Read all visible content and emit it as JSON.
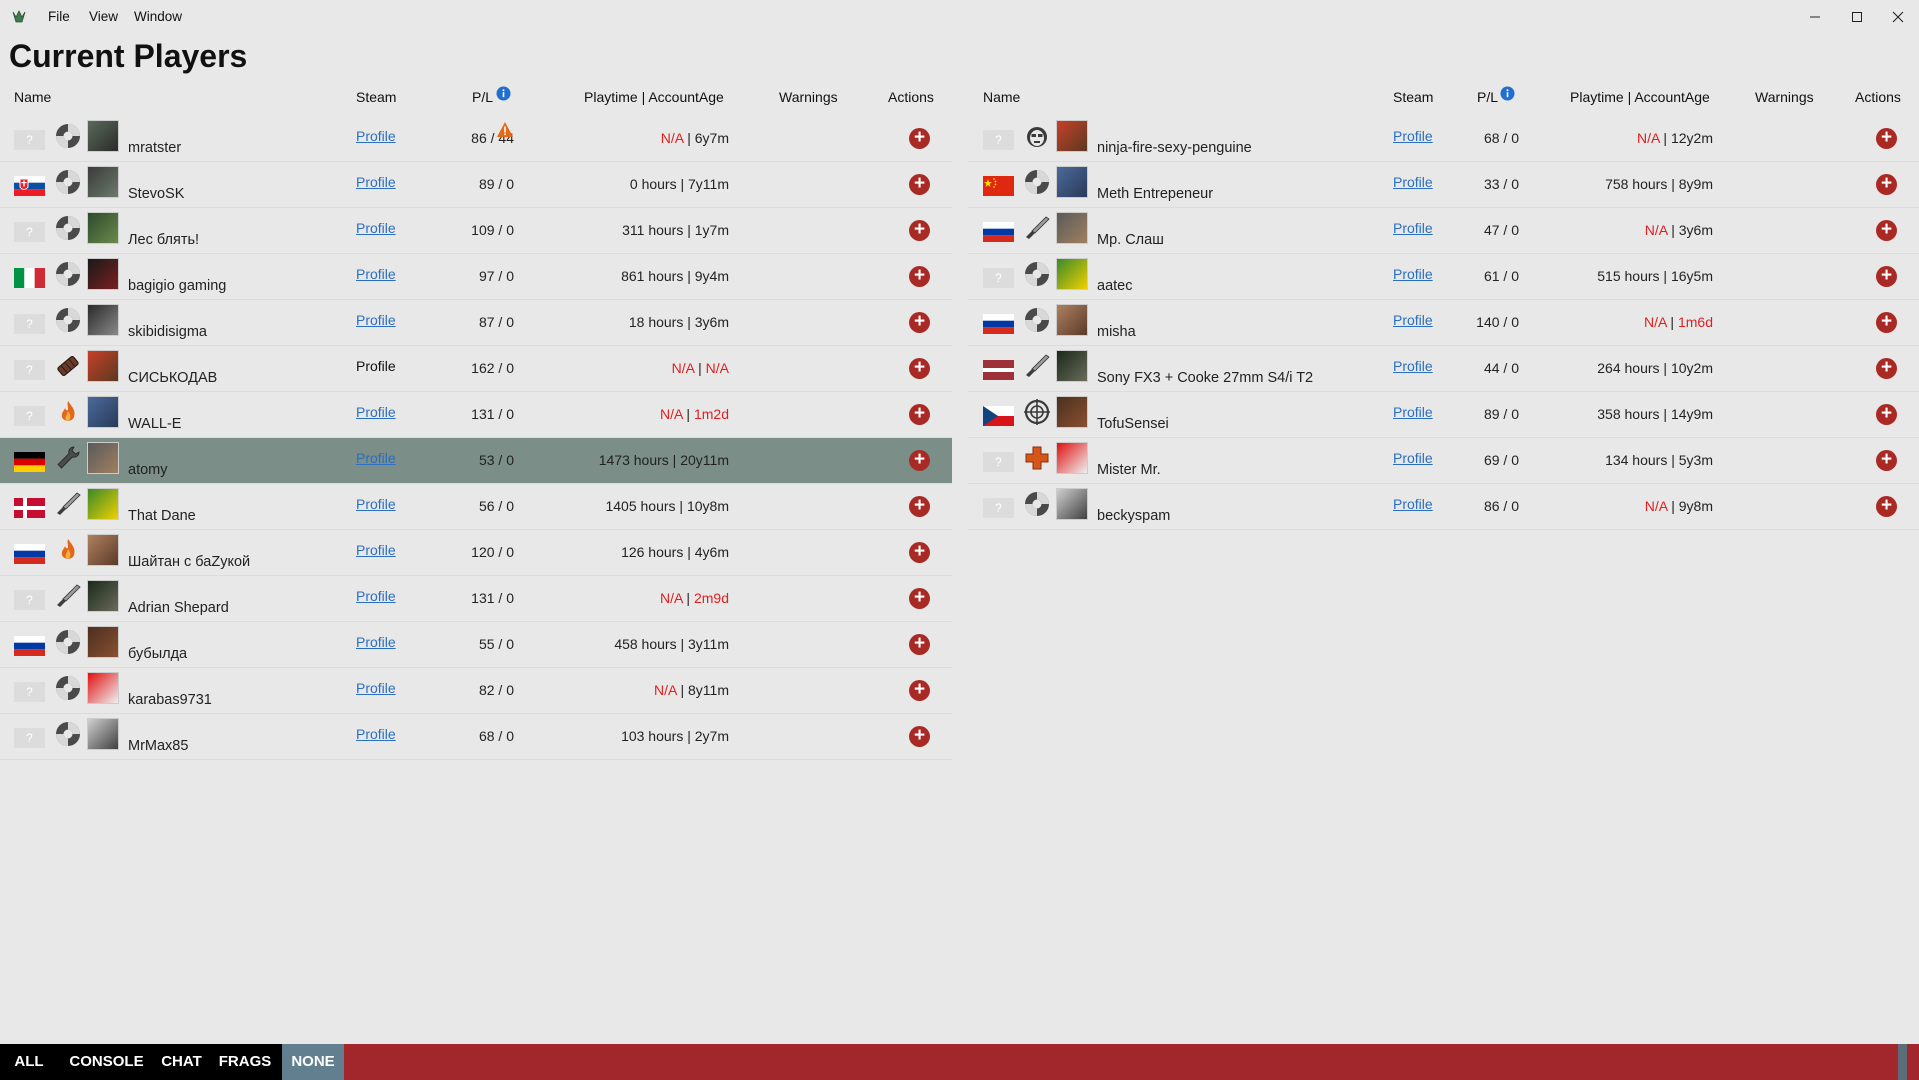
{
  "window": {
    "menu": [
      "File",
      "View",
      "Window"
    ],
    "controls": [
      "minimize-icon",
      "maximize-icon",
      "close-icon"
    ]
  },
  "page_title": "Current Players",
  "columns": {
    "name": "Name",
    "steam": "Steam",
    "pl": "P/L",
    "playtime": "Playtime | AccountAge",
    "warnings": "Warnings",
    "actions": "Actions"
  },
  "colors": {
    "na_red": "#e02020",
    "link_blue": "#2b6fc0",
    "action_red": "#a92a24",
    "selected_row": "#7b8e88",
    "bottom_bar": "#a1272c",
    "active_tab": "#617f8f"
  },
  "left_players": [
    {
      "flag": "unknown",
      "class_icon": "tf2-icon",
      "name": "mratster",
      "steam": "Profile",
      "pl": "86 / 44",
      "pl_warning": true,
      "playtime": "N/A",
      "playtime_na": true,
      "age": "6y7m",
      "age_na": false
    },
    {
      "flag": "sk",
      "class_icon": "tf2-icon",
      "name": "StevoSK",
      "steam": "Profile",
      "pl": "89 / 0",
      "playtime": "0 hours",
      "playtime_na": false,
      "age": "7y11m",
      "age_na": false
    },
    {
      "flag": "unknown",
      "class_icon": "tf2-icon",
      "name": "Лес блять!",
      "steam": "Profile",
      "pl": "109 / 0",
      "playtime": "311 hours",
      "playtime_na": false,
      "age": "1y7m",
      "age_na": false
    },
    {
      "flag": "it",
      "class_icon": "tf2-icon",
      "name": "bagigio gaming",
      "steam": "Profile",
      "pl": "97 / 0",
      "playtime": "861 hours",
      "playtime_na": false,
      "age": "9y4m",
      "age_na": false
    },
    {
      "flag": "unknown",
      "class_icon": "tf2-icon",
      "name": "skibidisigma",
      "steam": "Profile",
      "pl": "87 / 0",
      "playtime": "18 hours",
      "playtime_na": false,
      "age": "3y6m",
      "age_na": false
    },
    {
      "flag": "unknown",
      "class_icon": "sticky-icon",
      "name": "СИСЬКОДАВ",
      "steam": "Profile",
      "steam_plain": true,
      "pl": "162 / 0",
      "playtime": "N/A",
      "playtime_na": true,
      "age": "N/A",
      "age_na": true
    },
    {
      "flag": "unknown",
      "class_icon": "fire-icon",
      "name": "WALL-E",
      "steam": "Profile",
      "pl": "131 / 0",
      "playtime": "N/A",
      "playtime_na": true,
      "age": "1m2d",
      "age_na": true
    },
    {
      "flag": "de",
      "class_icon": "wrench-icon",
      "name": "atomy",
      "steam": "Profile",
      "pl": "53 / 0",
      "playtime": "1473 hours",
      "playtime_na": false,
      "age": "20y11m",
      "age_na": false,
      "selected": true
    },
    {
      "flag": "dk",
      "class_icon": "knife-icon",
      "name": "That Dane",
      "steam": "Profile",
      "pl": "56 / 0",
      "playtime": "1405 hours",
      "playtime_na": false,
      "age": "10y8m",
      "age_na": false
    },
    {
      "flag": "ru",
      "class_icon": "fire-icon",
      "name": "Шайтан с баZукой",
      "steam": "Profile",
      "pl": "120 / 0",
      "playtime": "126 hours",
      "playtime_na": false,
      "age": "4y6m",
      "age_na": false
    },
    {
      "flag": "unknown",
      "class_icon": "knife-icon",
      "name": "Adrian Shepard",
      "steam": "Profile",
      "pl": "131 / 0",
      "playtime": "N/A",
      "playtime_na": true,
      "age": "2m9d",
      "age_na": true
    },
    {
      "flag": "ru",
      "class_icon": "tf2-icon",
      "name": "бубылда",
      "steam": "Profile",
      "pl": "55 / 0",
      "playtime": "458 hours",
      "playtime_na": false,
      "age": "3y11m",
      "age_na": false
    },
    {
      "flag": "unknown",
      "class_icon": "tf2-icon",
      "name": "karabas9731",
      "steam": "Profile",
      "pl": "82 / 0",
      "playtime": "N/A",
      "playtime_na": true,
      "age": "8y11m",
      "age_na": false
    },
    {
      "flag": "unknown",
      "class_icon": "tf2-icon",
      "name": "MrMax85",
      "steam": "Profile",
      "pl": "68 / 0",
      "playtime": "103 hours",
      "playtime_na": false,
      "age": "2y7m",
      "age_na": false
    }
  ],
  "right_players": [
    {
      "flag": "unknown",
      "class_icon": "spy-icon",
      "name": "ninja-fire-sexy-penguine",
      "steam": "Profile",
      "pl": "68 / 0",
      "playtime": "N/A",
      "playtime_na": true,
      "age": "12y2m",
      "age_na": false
    },
    {
      "flag": "cn",
      "class_icon": "tf2-icon",
      "name": "Meth Entrepeneur",
      "steam": "Profile",
      "pl": "33 / 0",
      "playtime": "758 hours",
      "playtime_na": false,
      "age": "8y9m",
      "age_na": false
    },
    {
      "flag": "ru",
      "class_icon": "knife-icon",
      "name": "Мр. Слаш",
      "steam": "Profile",
      "pl": "47 / 0",
      "playtime": "N/A",
      "playtime_na": true,
      "age": "3y6m",
      "age_na": false
    },
    {
      "flag": "unknown",
      "class_icon": "tf2-icon",
      "name": "aatec",
      "steam": "Profile",
      "pl": "61 / 0",
      "playtime": "515 hours",
      "playtime_na": false,
      "age": "16y5m",
      "age_na": false
    },
    {
      "flag": "ru",
      "class_icon": "tf2-icon",
      "name": "misha",
      "steam": "Profile",
      "pl": "140 / 0",
      "playtime": "N/A",
      "playtime_na": true,
      "age": "1m6d",
      "age_na": true
    },
    {
      "flag": "lv",
      "class_icon": "knife-icon",
      "name": "Sony FX3 + Cooke 27mm S4/i T2",
      "steam": "Profile",
      "pl": "44 / 0",
      "playtime": "264 hours",
      "playtime_na": false,
      "age": "10y2m",
      "age_na": false
    },
    {
      "flag": "cz",
      "class_icon": "crosshair-icon",
      "name": "TofuSensei",
      "steam": "Profile",
      "pl": "89 / 0",
      "playtime": "358 hours",
      "playtime_na": false,
      "age": "14y9m",
      "age_na": false
    },
    {
      "flag": "unknown",
      "class_icon": "medic-cross-icon",
      "name": "Mister Mr.",
      "steam": "Profile",
      "pl": "69 / 0",
      "playtime": "134 hours",
      "playtime_na": false,
      "age": "5y3m",
      "age_na": false
    },
    {
      "flag": "unknown",
      "class_icon": "tf2-icon",
      "name": "beckyspam",
      "steam": "Profile",
      "pl": "86 / 0",
      "playtime": "N/A",
      "playtime_na": true,
      "age": "9y8m",
      "age_na": false
    }
  ],
  "separator": " | ",
  "unknown_flag_text": "?",
  "tabs": [
    "ALL",
    "CONSOLE",
    "CHAT",
    "FRAGS",
    "NONE"
  ],
  "active_tab": "NONE"
}
